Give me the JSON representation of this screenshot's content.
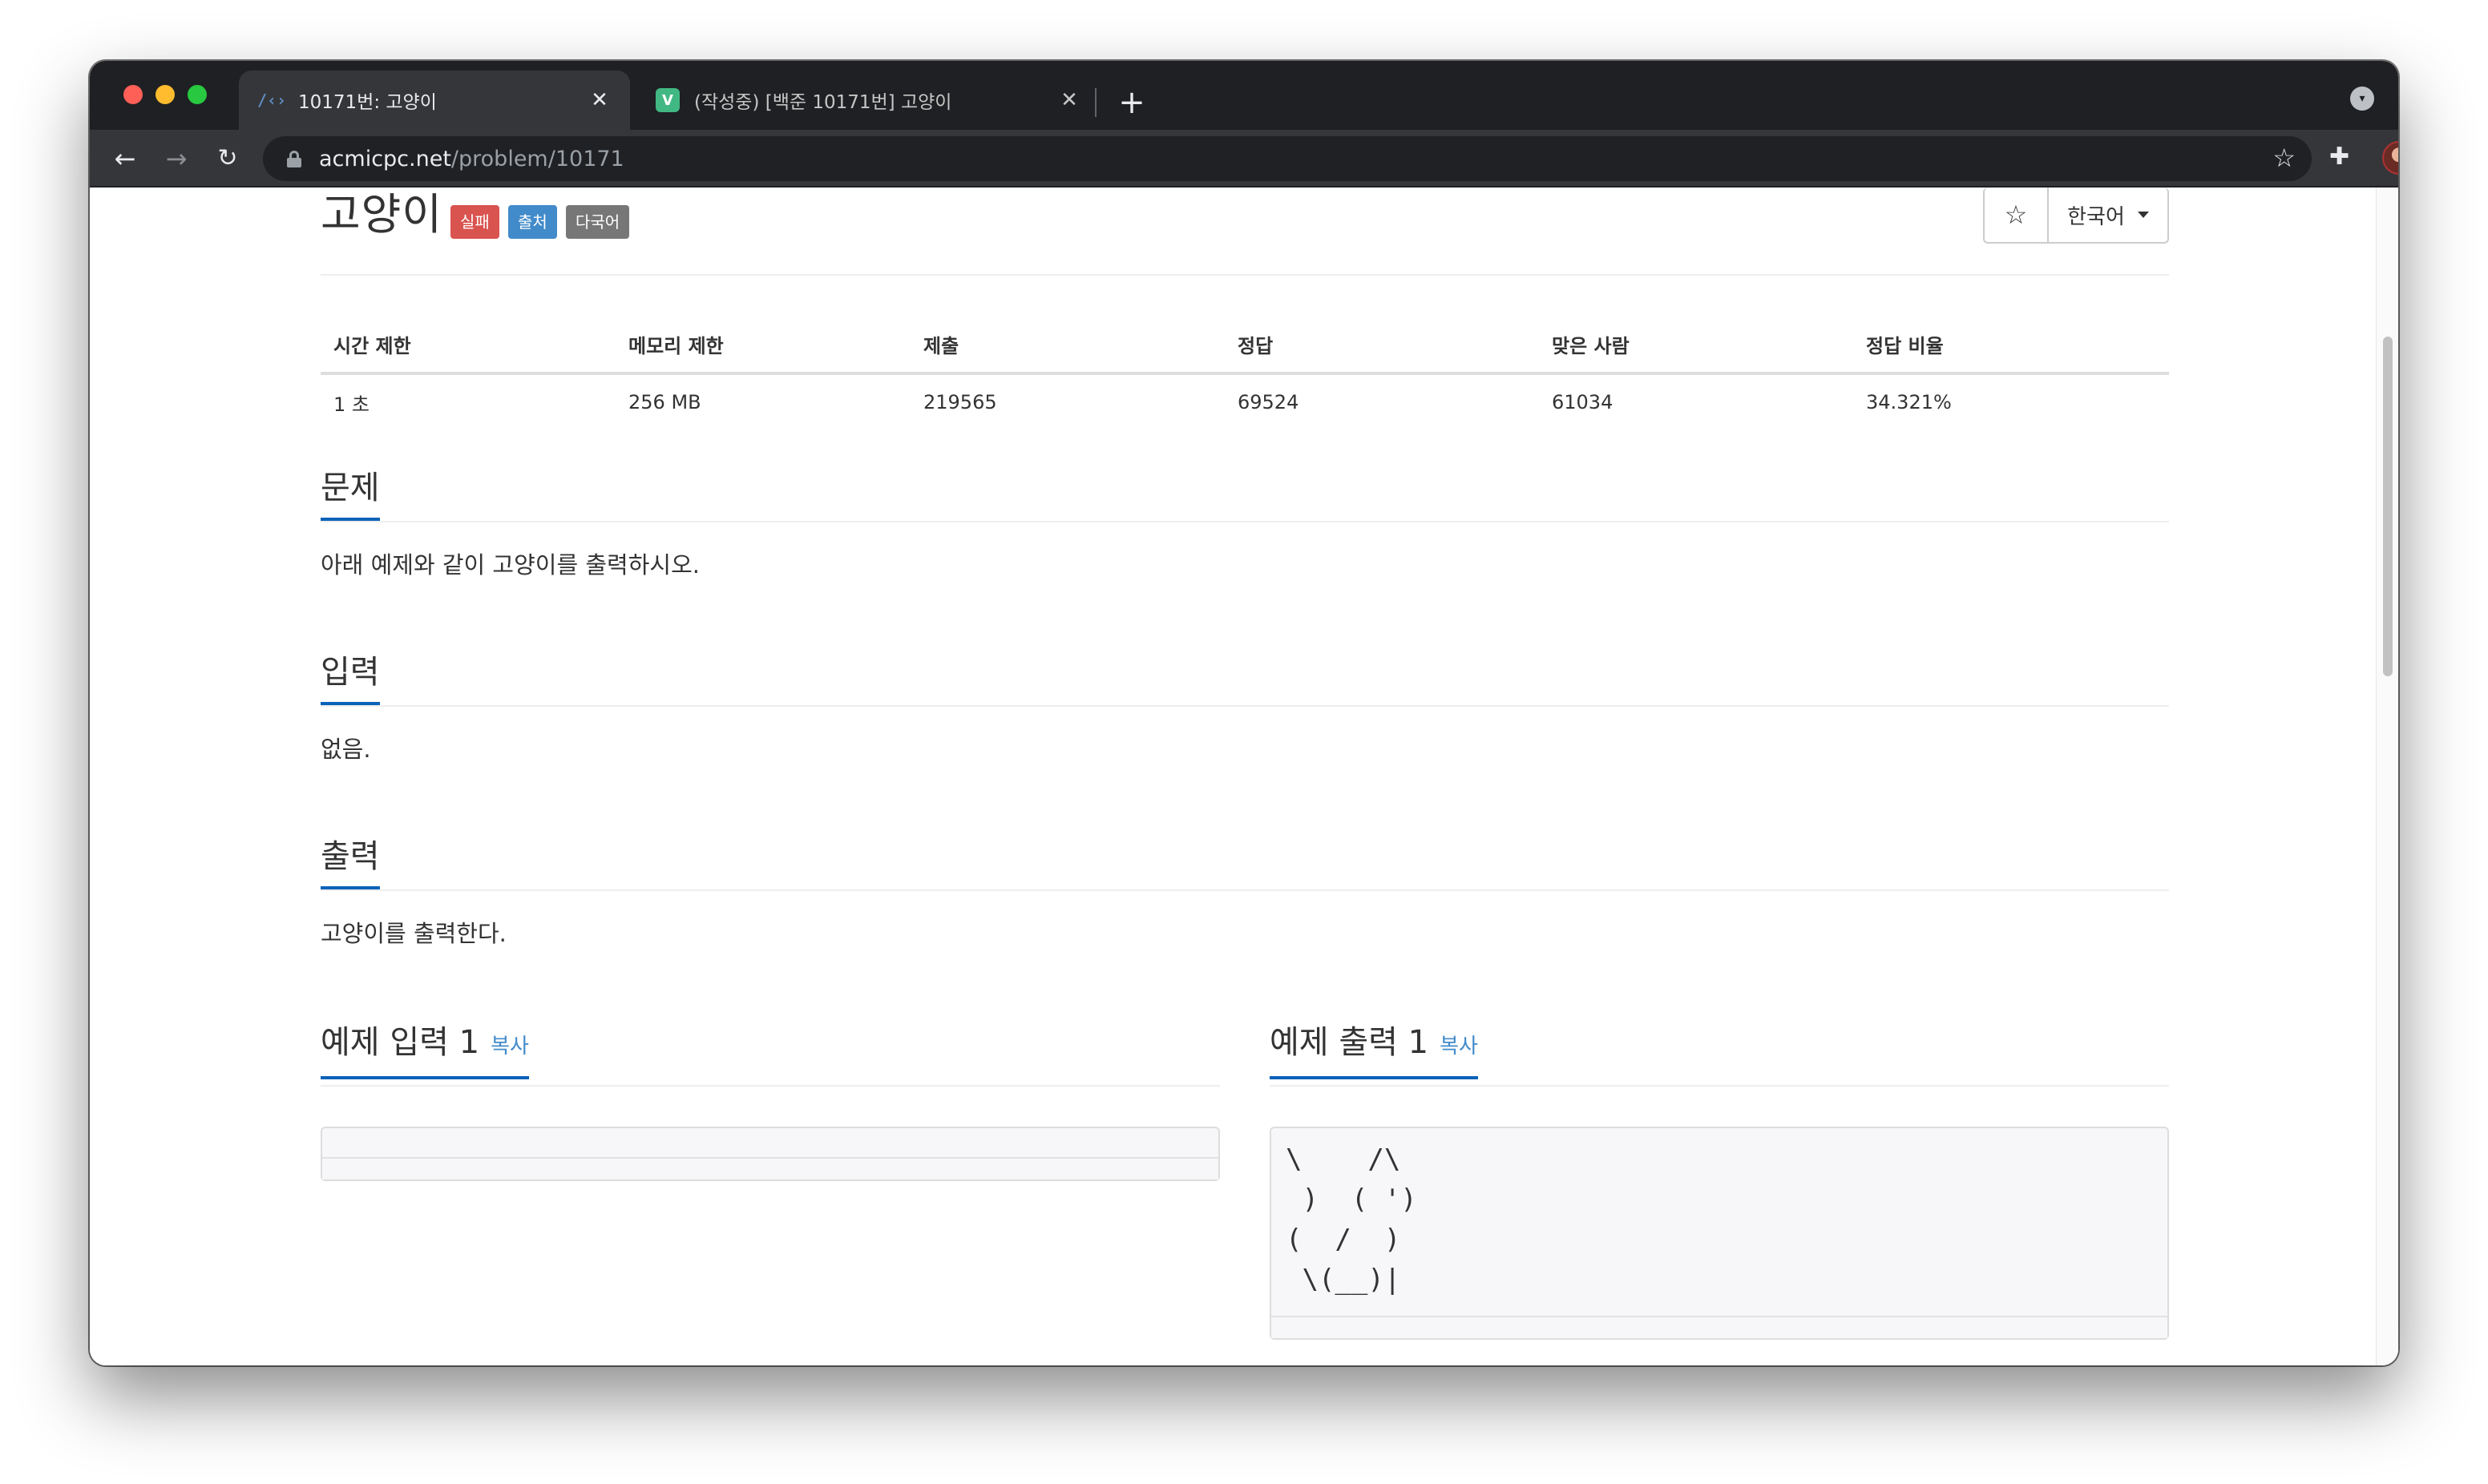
{
  "browser": {
    "tabs": [
      {
        "title": "10171번: 고양이",
        "favicon": "code-brackets-icon",
        "active": true
      },
      {
        "title": "(작성중) [백준 10171번] 고양이",
        "favicon": "v-logo-icon",
        "active": false
      }
    ],
    "close_glyph": "✕",
    "new_tab_glyph": "+",
    "url_host": "acmicpc.net",
    "url_path": "/problem/10171",
    "back_glyph": "←",
    "forward_glyph": "→",
    "reload_glyph": "↻",
    "bookmark_glyph": "☆",
    "extension_glyph": "✚",
    "menu_glyph": "⋮",
    "favicon_code_glyph": "/‹›",
    "favicon_v_glyph": "V"
  },
  "problem": {
    "title": "고양이",
    "labels": {
      "fail": "실패",
      "source": "출처",
      "multilang": "다국어"
    },
    "star_glyph": "☆",
    "language": "한국어"
  },
  "stats": {
    "headers": [
      "시간 제한",
      "메모리 제한",
      "제출",
      "정답",
      "맞은 사람",
      "정답 비율"
    ],
    "values": [
      "1 초",
      "256 MB",
      "219565",
      "69524",
      "61034",
      "34.321%"
    ]
  },
  "sections": {
    "problem": {
      "heading": "문제",
      "text": "아래 예제와 같이 고양이를 출력하시오."
    },
    "input": {
      "heading": "입력",
      "text": "없음."
    },
    "output": {
      "heading": "출력",
      "text": "고양이를 출력한다."
    }
  },
  "samples": {
    "input_heading": "예제 입력 1",
    "output_heading": "예제 출력 1",
    "copy_label": "복사",
    "input_text": "",
    "output_text": "\\    /\\\n )  ( ')\n(  /  )\n \\(__)|"
  }
}
